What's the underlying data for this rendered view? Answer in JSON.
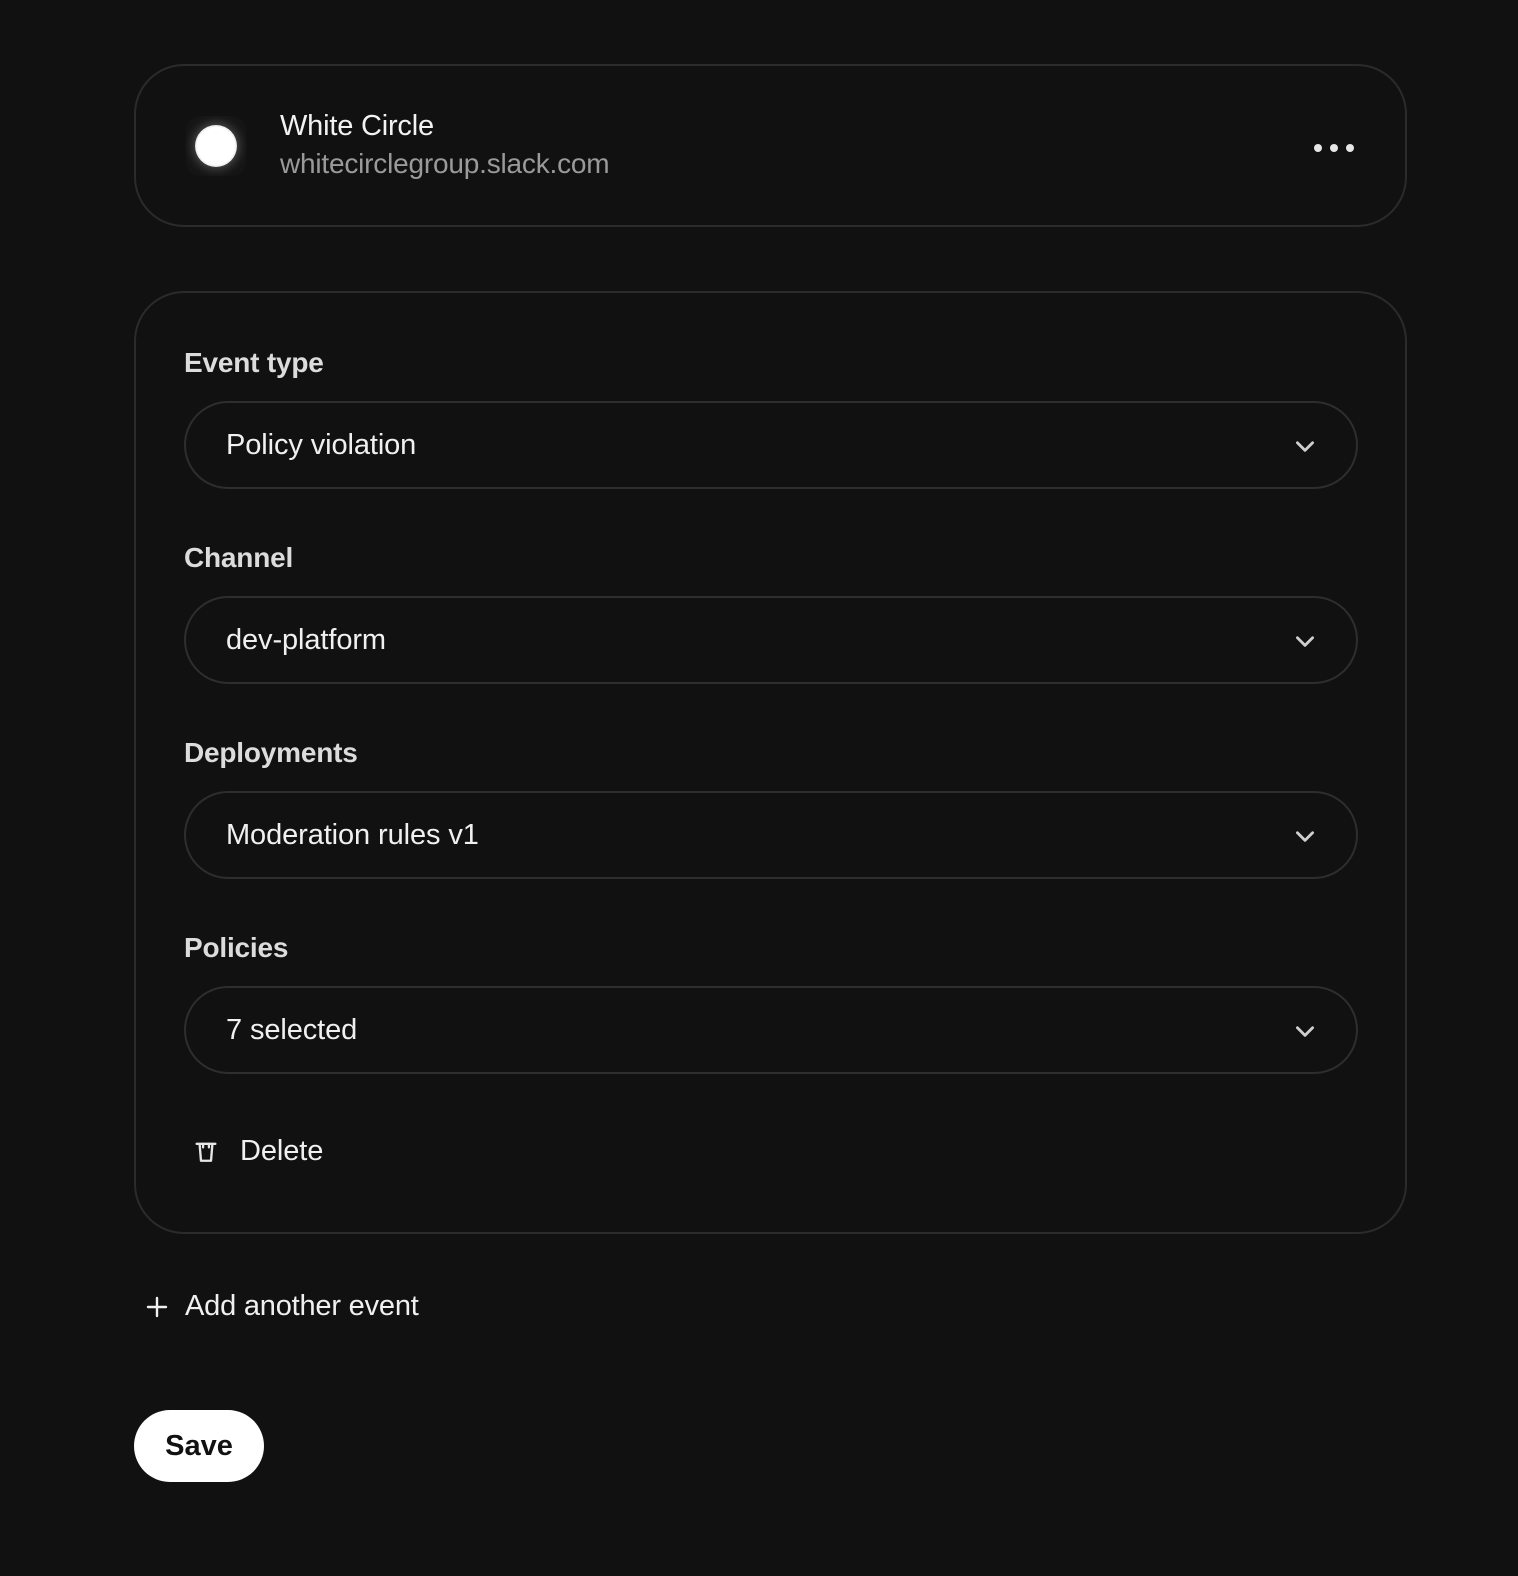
{
  "workspace": {
    "name": "White Circle",
    "domain": "whitecirclegroup.slack.com",
    "logo_icon": "white-circle-icon",
    "menu_icon": "more-horizontal-icon"
  },
  "event": {
    "fields": [
      {
        "label": "Event type",
        "value": "Policy violation"
      },
      {
        "label": "Channel",
        "value": "dev-platform"
      },
      {
        "label": "Deployments",
        "value": "Moderation rules v1"
      },
      {
        "label": "Policies",
        "value": "7 selected"
      }
    ],
    "delete_label": "Delete",
    "delete_icon": "trash-icon"
  },
  "add_event_label": "Add another event",
  "add_icon": "plus-icon",
  "save_label": "Save",
  "colors": {
    "background": "#111111",
    "border": "#2b2b2b",
    "text": "#f0f0f0",
    "muted": "#9a9a9a",
    "save_bg": "#ffffff"
  }
}
